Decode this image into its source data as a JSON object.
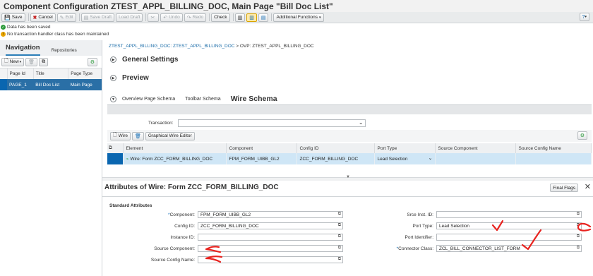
{
  "title": "Component Configuration ZTEST_APPL_BILLING_DOC, Main Page \"Bill Doc List\"",
  "toolbar": {
    "save": "Save",
    "cancel": "Cancel",
    "edit": "Edit",
    "save_draft": "Save Draft",
    "load_draft": "Load Draft",
    "undo": "Undo",
    "redo": "Redo",
    "check": "Check",
    "additional_functions": "Additional Functions"
  },
  "messages": [
    "Data has been saved",
    "No transaction handler class has been maintained"
  ],
  "navigation": {
    "tab_active": "Navigation",
    "tab_other": "Repositories",
    "new_button": "New",
    "columns": [
      "Page Id",
      "Title",
      "Page Type"
    ],
    "rows": [
      {
        "page_id": "PAGE_1",
        "title": "Bill Doc List",
        "page_type": "Main Page"
      }
    ]
  },
  "main": {
    "breadcrumb_link": "ZTEST_APPL_BILLING_DOC: ZTEST_APPL_BILLING_DOC",
    "breadcrumb_rest": " > OVP: ZTEST_APPL_BILLING_DOC",
    "general_settings": "General Settings",
    "preview": "Preview",
    "tabs": [
      "Overview Page Schema",
      "Toolbar Schema",
      "Wire Schema"
    ],
    "transaction_label": "Transaction:",
    "wire_button": "Wire",
    "graphical_editor_button": "Graphical Wire Editor",
    "table_columns": [
      "Element",
      "Component",
      "Config ID",
      "Port Type",
      "Source Component",
      "Source Config Name"
    ],
    "table_row": {
      "element": "Wire: Form ZCC_FORM_BILLING_DOC",
      "component": "FPM_FORM_UIBB_GL2",
      "config_id": "ZCC_FORM_BILLING_DOC",
      "port_type": "Lead Selection",
      "source_component": "",
      "source_config_name": ""
    }
  },
  "attributes": {
    "title": "Attributes of Wire: Form ZCC_FORM_BILLING_DOC",
    "final_flags": "Final Flags",
    "section": "Standard Attributes",
    "left": [
      {
        "label": "Component:",
        "value": "FPM_FORM_UIBB_GL2"
      },
      {
        "label": "Config ID:",
        "value": "ZCC_FORM_BILLING_DOC"
      },
      {
        "label": "Instance ID:",
        "value": ""
      },
      {
        "label": "Source Component:",
        "value": ""
      },
      {
        "label": "Source Config Name:",
        "value": ""
      }
    ],
    "right": [
      {
        "label": "Srce Inst. ID:",
        "value": ""
      },
      {
        "label": "Port Type:",
        "value": "Lead Selection"
      },
      {
        "label": "Port Identifier:",
        "value": ""
      },
      {
        "label": "Connector Class:",
        "value": "ZCL_BILL_CONNECTOR_LIST_FORM"
      }
    ]
  },
  "colors": {
    "accent": "#0a66b0",
    "selection": "#cfe6f6",
    "annotation": "#e8231f"
  }
}
